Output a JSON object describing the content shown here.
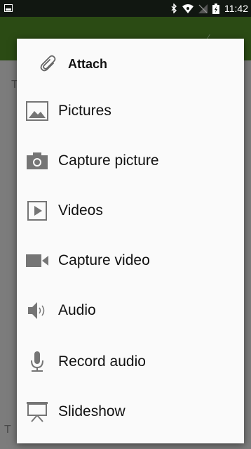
{
  "status_bar": {
    "time": "11:42",
    "icons": [
      "image-notification-icon",
      "bluetooth-icon",
      "wifi-icon",
      "no-signal-icon",
      "battery-icon"
    ]
  },
  "background": {
    "partial_text_top": "T",
    "partial_text_bottom": "T"
  },
  "dialog": {
    "title": "Attach",
    "title_icon": "paperclip-icon",
    "items": [
      {
        "label": "Pictures",
        "icon": "picture-icon"
      },
      {
        "label": "Capture picture",
        "icon": "camera-icon"
      },
      {
        "label": "Videos",
        "icon": "video-file-icon"
      },
      {
        "label": "Capture video",
        "icon": "video-camera-icon"
      },
      {
        "label": "Audio",
        "icon": "speaker-icon"
      },
      {
        "label": "Record audio",
        "icon": "microphone-icon"
      },
      {
        "label": "Slideshow",
        "icon": "slideshow-icon"
      }
    ]
  },
  "colors": {
    "status_bar": "#111711",
    "app_bar": "#2b4b14",
    "scrim": "#7c7c7c",
    "dialog_bg": "#fafafa",
    "icon_gray": "#757575"
  }
}
